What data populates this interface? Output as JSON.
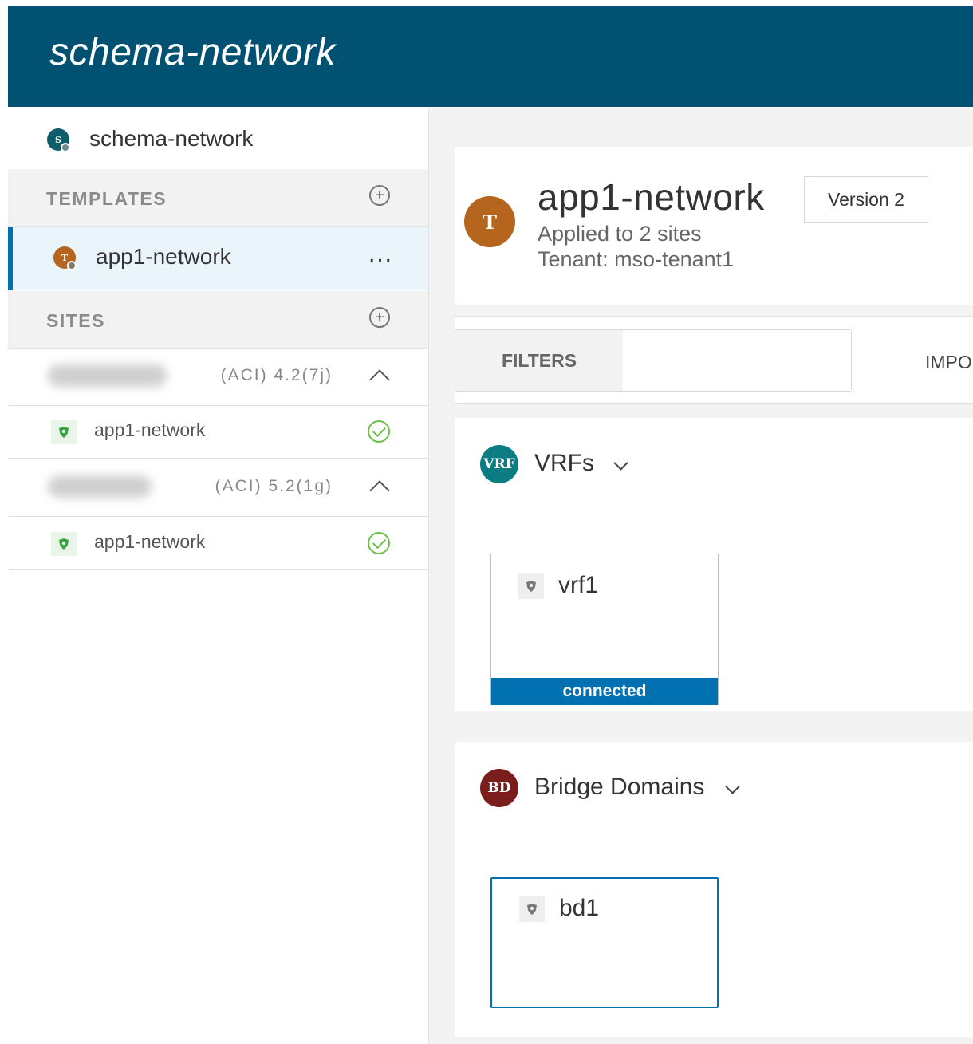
{
  "header": {
    "title": "schema-network"
  },
  "sidebar": {
    "schema_name": "schema-network",
    "templates": {
      "label": "TEMPLATES",
      "items": [
        {
          "name": "app1-network",
          "menu": "..."
        }
      ]
    },
    "sites": {
      "label": "SITES",
      "items": [
        {
          "version": "(ACI)  4.2(7j)",
          "template": "app1-network",
          "status": "synced"
        },
        {
          "version": "(ACI)  5.2(1g)",
          "template": "app1-network",
          "status": "synced"
        }
      ]
    }
  },
  "template_card": {
    "avatar_letter": "T",
    "name": "app1-network",
    "version": "Version 2",
    "applied": "Applied to 2 sites",
    "tenant": "Tenant: mso-tenant1"
  },
  "filters": {
    "label": "FILTERS",
    "value": "",
    "import_label": "IMPO"
  },
  "vrfs": {
    "icon_text": "VRF",
    "title": "VRFs",
    "items": [
      {
        "name": "vrf1",
        "status": "connected"
      }
    ]
  },
  "bridge_domains": {
    "icon_text": "BD",
    "title": "Bridge Domains",
    "items": [
      {
        "name": "bd1"
      }
    ]
  },
  "colors": {
    "header_bg": "#015173",
    "accent": "#0271b2",
    "template_avatar": "#b5651d",
    "vrf_icon": "#0a7c82",
    "bd_icon": "#7a1d1d",
    "check": "#6cc04a"
  }
}
